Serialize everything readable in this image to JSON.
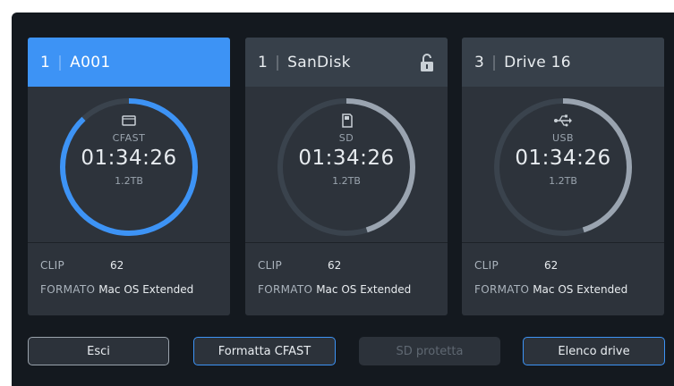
{
  "colors": {
    "background": "#14191f",
    "card": "#2d333b",
    "card_header": "#37404a",
    "active_accent": "#3d93f5",
    "ring_track": "#3a434d",
    "ring_active": "#3d93f5",
    "ring_inactive": "#9aa4b0"
  },
  "cards": [
    {
      "slot": "1",
      "name": "A001",
      "active": true,
      "locked": false,
      "media_icon": "cfast-card-icon",
      "media_type": "CFAST",
      "timecode": "01:34:26",
      "capacity": "1.2TB",
      "fill_fraction": 0.88,
      "clip_label": "CLIP",
      "clip_value": "62",
      "format_label": "FORMATO",
      "format_value": "Mac OS Extended"
    },
    {
      "slot": "1",
      "name": "SanDisk",
      "active": false,
      "locked": true,
      "media_icon": "sd-card-icon",
      "media_type": "SD",
      "timecode": "01:34:26",
      "capacity": "1.2TB",
      "fill_fraction": 0.45,
      "clip_label": "CLIP",
      "clip_value": "62",
      "format_label": "FORMATO",
      "format_value": "Mac OS Extended"
    },
    {
      "slot": "3",
      "name": "Drive 16",
      "active": false,
      "locked": false,
      "media_icon": "usb-icon",
      "media_type": "USB",
      "timecode": "01:34:26",
      "capacity": "1.2TB",
      "fill_fraction": 0.45,
      "clip_label": "CLIP",
      "clip_value": "62",
      "format_label": "FORMATO",
      "format_value": "Mac OS Extended"
    }
  ],
  "buttons": {
    "exit": "Esci",
    "format": "Formatta CFAST",
    "sd_protected": "SD protetta",
    "drive_list": "Elenco drive"
  }
}
